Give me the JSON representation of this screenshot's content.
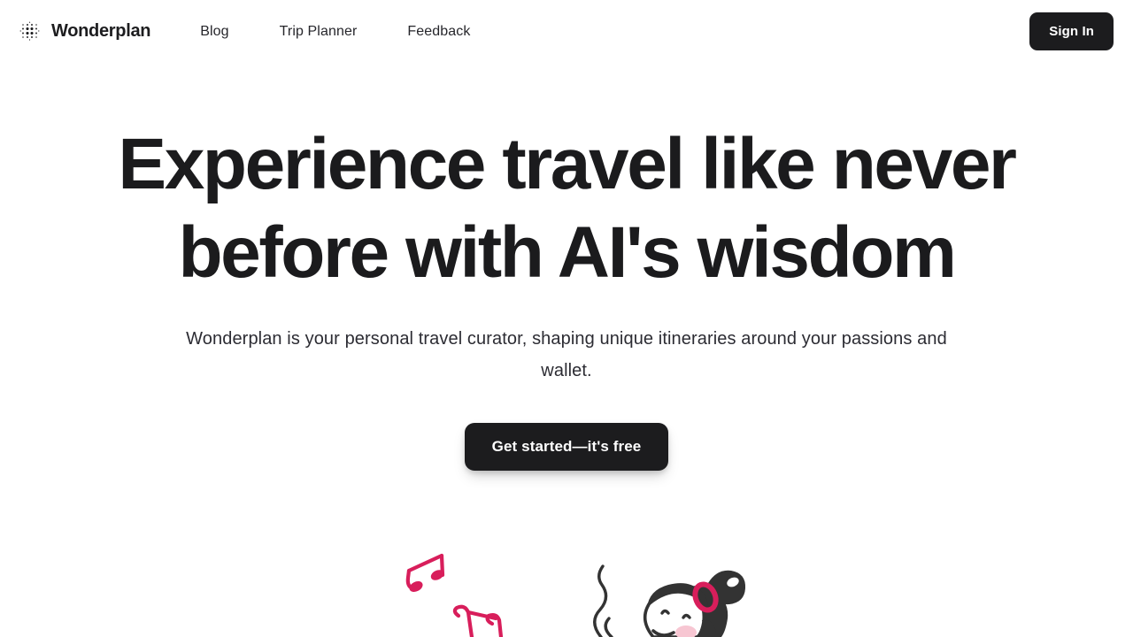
{
  "header": {
    "logo_icon": "dot-grid-logo-icon",
    "brand_name": "Wonderplan",
    "nav": [
      {
        "label": "Blog",
        "name": "nav-link-blog"
      },
      {
        "label": "Trip Planner",
        "name": "nav-link-trip-planner"
      },
      {
        "label": "Feedback",
        "name": "nav-link-feedback"
      }
    ],
    "sign_in_label": "Sign In"
  },
  "hero": {
    "headline": "Experience travel like never before with AI's wisdom",
    "subheadline": "Wonderplan is your personal travel curator, shaping unique itineraries around your passions and wallet.",
    "cta_label": "Get started—it's free"
  },
  "illustration": {
    "name": "girl-with-music-notes-illustration",
    "music_note_icon": "music-note-icon",
    "character_icon": "girl-character-icon"
  },
  "colors": {
    "page_background": "#ffffff",
    "text_primary": "#1b1b1d",
    "text_secondary": "#2c2c33",
    "button_background": "#1c1c1e",
    "button_text": "#ffffff",
    "accent_pink": "#d81e5b",
    "blush_pink": "#f7c6d2",
    "ink_dark": "#333333"
  }
}
